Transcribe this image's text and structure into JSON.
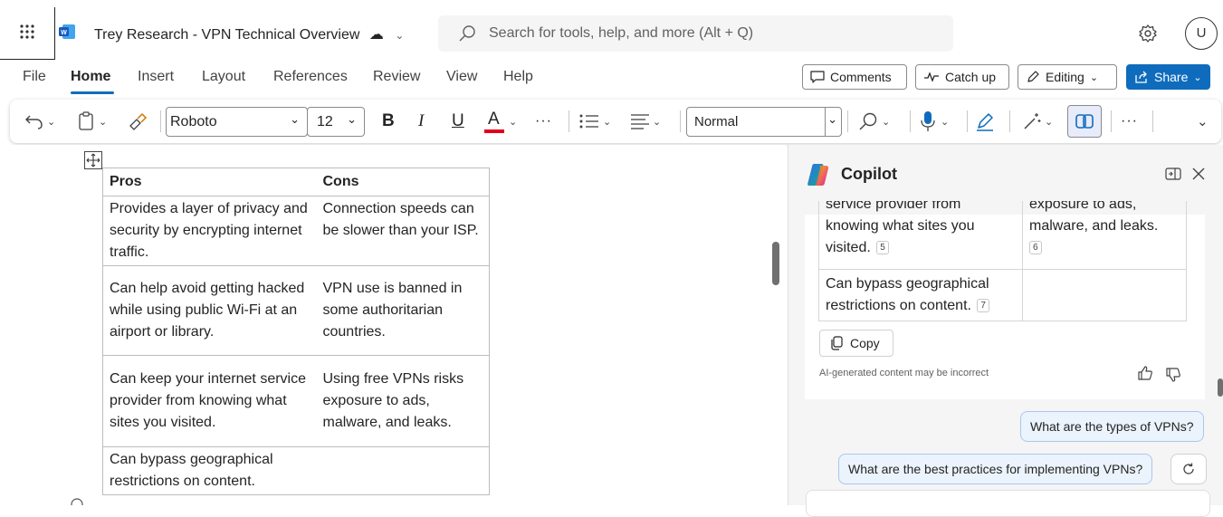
{
  "app": {
    "doc_title": "Trey Research - VPN Technical Overview",
    "search_placeholder": "Search for tools, help, and more (Alt + Q)",
    "avatar_initial": "U"
  },
  "ribbon": {
    "tabs": [
      "File",
      "Home",
      "Insert",
      "Layout",
      "References",
      "Review",
      "View",
      "Help"
    ],
    "active_tab": "Home",
    "comments_label": "Comments",
    "catchup_label": "Catch up",
    "editing_label": "Editing",
    "share_label": "Share"
  },
  "toolbar": {
    "font_name": "Roboto",
    "font_size": "12",
    "bold": "B",
    "italic": "I",
    "underline": "U",
    "font_color_letter": "A",
    "style_name": "Normal",
    "more": "···"
  },
  "document": {
    "table": {
      "headers": [
        "Pros",
        "Cons"
      ],
      "rows": [
        [
          "Provides a layer of privacy and security by encrypting internet traffic.",
          "Connection speeds can be slower than your ISP."
        ],
        [
          "Can help avoid getting hacked while using public Wi-Fi at an airport or library.",
          "VPN use is banned in some authoritarian countries."
        ],
        [
          "Can keep your internet service provider from knowing what sites you visited.",
          "Using free VPNs risks exposure to ads, malware, and leaks."
        ],
        [
          "Can bypass geographical restrictions on content.",
          ""
        ]
      ]
    }
  },
  "copilot": {
    "title": "Copilot",
    "table_rows": [
      {
        "pro": "service provider from knowing what sites you visited.",
        "pro_cite": "5",
        "con": "exposure to ads, malware, and leaks.",
        "con_cite": "6"
      },
      {
        "pro": "Can bypass geographical restrictions on content.",
        "pro_cite": "7",
        "con": "",
        "con_cite": ""
      }
    ],
    "copy_label": "Copy",
    "ai_note": "AI-generated content may be incorrect",
    "suggestion_1": "What are the types of VPNs?",
    "suggestion_2": "What are the best practices for implementing VPNs?"
  },
  "colors": {
    "accent": "#0f6cbd",
    "font_color_bar": "#e3001b"
  }
}
